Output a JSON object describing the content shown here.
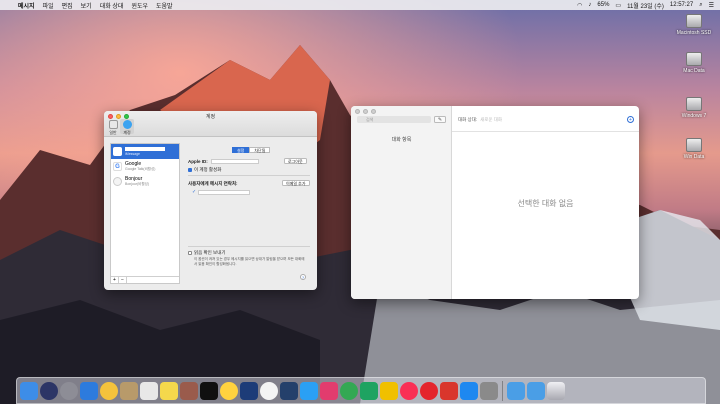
{
  "menubar": {
    "app_name": "메시지",
    "items": [
      "파일",
      "편집",
      "보기",
      "대화 상대",
      "윈도우",
      "도움말"
    ],
    "battery": "65%",
    "date": "11월 23일 (수)",
    "time": "12:57:27"
  },
  "desktop_icons": [
    "Macintosh SSD",
    "Mac Data",
    "Windows 7",
    "Win Data"
  ],
  "accounts_window": {
    "title": "계정",
    "toolbar": {
      "general": "일반",
      "accounts": "계정"
    },
    "accounts": [
      {
        "name": "",
        "subtitle": "iMessage",
        "selected": true
      },
      {
        "name": "Google",
        "subtitle": "Google Talk(비활성)"
      },
      {
        "name": "Bonjour",
        "subtitle": "Bonjour(비활성)"
      }
    ],
    "segments": [
      "설정",
      "차단됨"
    ],
    "apple_id_label": "Apple ID:",
    "sign_out": "로그아웃",
    "enable_account": "이 계정 활성화",
    "reach_label": "사용자에게 메시지 연락처:",
    "add_email": "이메일 추가",
    "read_receipts_label": "읽음 확인 보내기",
    "read_receipts_desc": "이 옵션이 켜져 있는 경우 메시지를 읽으면 상대가 알림을 받으며 모든 대화에서 읽음 확인이 활성화됩니다.",
    "footer_add": "+",
    "footer_remove": "−"
  },
  "messages_window": {
    "search_placeholder": "검색",
    "list_title": "대화 항목",
    "to_label": "대화 상대:",
    "to_placeholder": "새로운 대화",
    "empty_text": "선택한 대화 없음"
  },
  "dock": {
    "colors": [
      "#3d8de8",
      "#2c3566",
      "#8d8d96",
      "#2d7bdd",
      "#f4c23c",
      "#b89a6a",
      "#e8e8e8",
      "#f4d84c",
      "#9a5b4c",
      "#101010",
      "#ffd23f",
      "#1d3c78",
      "#f4f4f4",
      "#24406b",
      "#2aa0f4",
      "#e23c6e",
      "#33a853",
      "#1ea361",
      "#f0c000",
      "#fa2f55",
      "#e4242c",
      "#d9362c",
      "#1e88f0",
      "#8a8a8a",
      "#4a9ee6",
      "#4a9ee6",
      "#c0c0c8"
    ]
  }
}
